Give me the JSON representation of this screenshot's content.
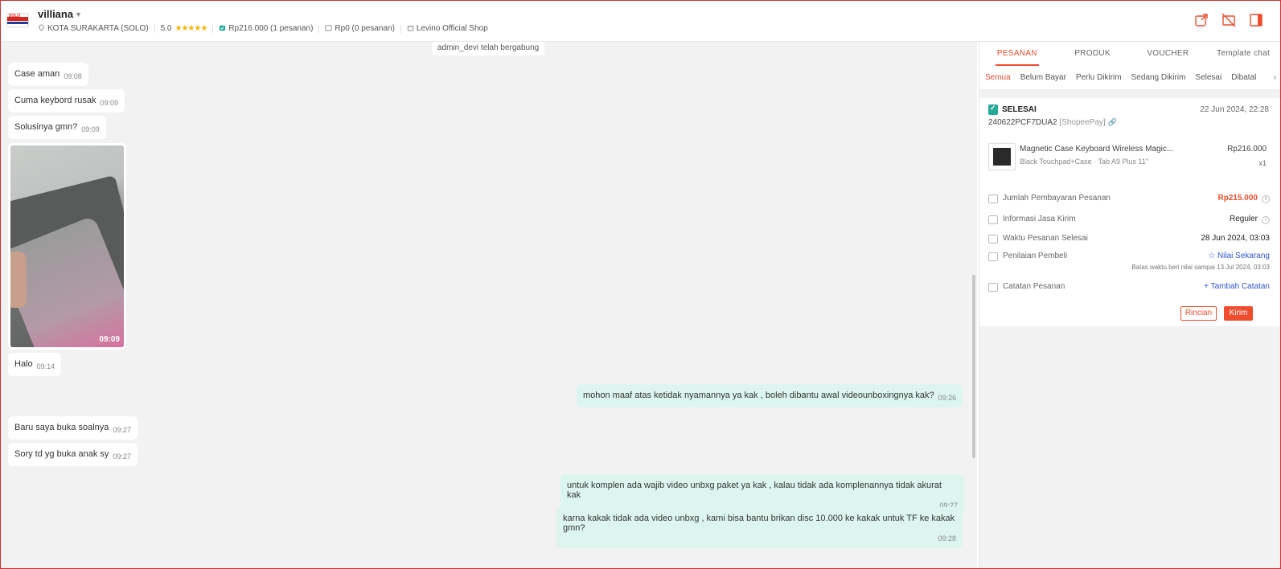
{
  "header": {
    "username": "villiana",
    "location": "KOTA SURAKARTA (SOLO)",
    "rating": "5.0",
    "stars": "★★★★★",
    "orders_paid": "Rp216.000 (1 pesanan)",
    "orders_unpaid": "Rp0 (0 pesanan)",
    "shop": "Levino Official Shop",
    "logo_text": "SOLO"
  },
  "chat": {
    "system_message": "admin_devi telah bergabung",
    "messages": [
      {
        "dir": "in",
        "text": "Case aman",
        "time": "09:08"
      },
      {
        "dir": "in",
        "text": "Cuma keybord rusak",
        "time": "09:09"
      },
      {
        "dir": "in",
        "text": "Solusinya gmn?",
        "time": "09:09"
      },
      {
        "dir": "in",
        "type": "video",
        "time": "09:09"
      },
      {
        "dir": "in",
        "text": "Halo",
        "time": "09:14"
      },
      {
        "dir": "out",
        "text": "mohon maaf atas ketidak nyamannya ya kak , boleh dibantu awal  videounboxingnya kak?",
        "time": "09:26"
      },
      {
        "dir": "in",
        "text": "Baru saya buka soalnya",
        "time": "09:27"
      },
      {
        "dir": "in",
        "text": "Sory td yg buka anak sy",
        "time": "09:27"
      },
      {
        "dir": "out",
        "text": "untuk komplen ada wajib video unbxg paket ya kak , kalau tidak ada komplenannya tidak akurat kak",
        "time": "09:27"
      },
      {
        "dir": "out",
        "text": "karna kakak tidak ada video unbxg , kami bisa bantu brikan disc 10.000 ke kakak untuk TF ke kakak gmn?",
        "time": "09:28"
      }
    ]
  },
  "panel": {
    "tabs": [
      "PESANAN",
      "PRODUK",
      "VOUCHER",
      "Template chat"
    ],
    "subtabs": [
      "Semua",
      "Belum Bayar",
      "Perlu Dikirim",
      "Sedang Dikirim",
      "Selesai",
      "Dibatal"
    ],
    "order": {
      "status": "SELESAI",
      "date": "22 Jun 2024, 22:28",
      "id": "240622PCF7DUA2",
      "payment": "[ShopeePay]",
      "product_name": "Magnetic Case Keyboard Wireless Magic...",
      "product_variant": "Black Touchpad+Case · Tab A9 Plus 11\"",
      "product_price": "Rp216.000",
      "product_qty": "x1",
      "payment_label": "Jumlah Pembayaran Pesanan",
      "payment_value": "Rp215.000",
      "shipping_label": "Informasi Jasa Kirim",
      "shipping_value": "Reguler",
      "done_label": "Waktu Pesanan Selesai",
      "done_value": "28 Jun 2024, 03:03",
      "review_label": "Penilaian Pembeli",
      "review_value": "Nilai Sekarang",
      "review_note": "Batas waktu beri nilai sampai 13 Jul 2024, 03:03",
      "note_label": "Catatan Pesanan",
      "note_value": "Tambah Catatan",
      "btn_detail": "Rincian",
      "btn_send": "Kirim"
    }
  },
  "colors": {
    "accent": "#ee4d2d",
    "out_bubble": "#dcf6ef",
    "status_green": "#26aa99"
  }
}
